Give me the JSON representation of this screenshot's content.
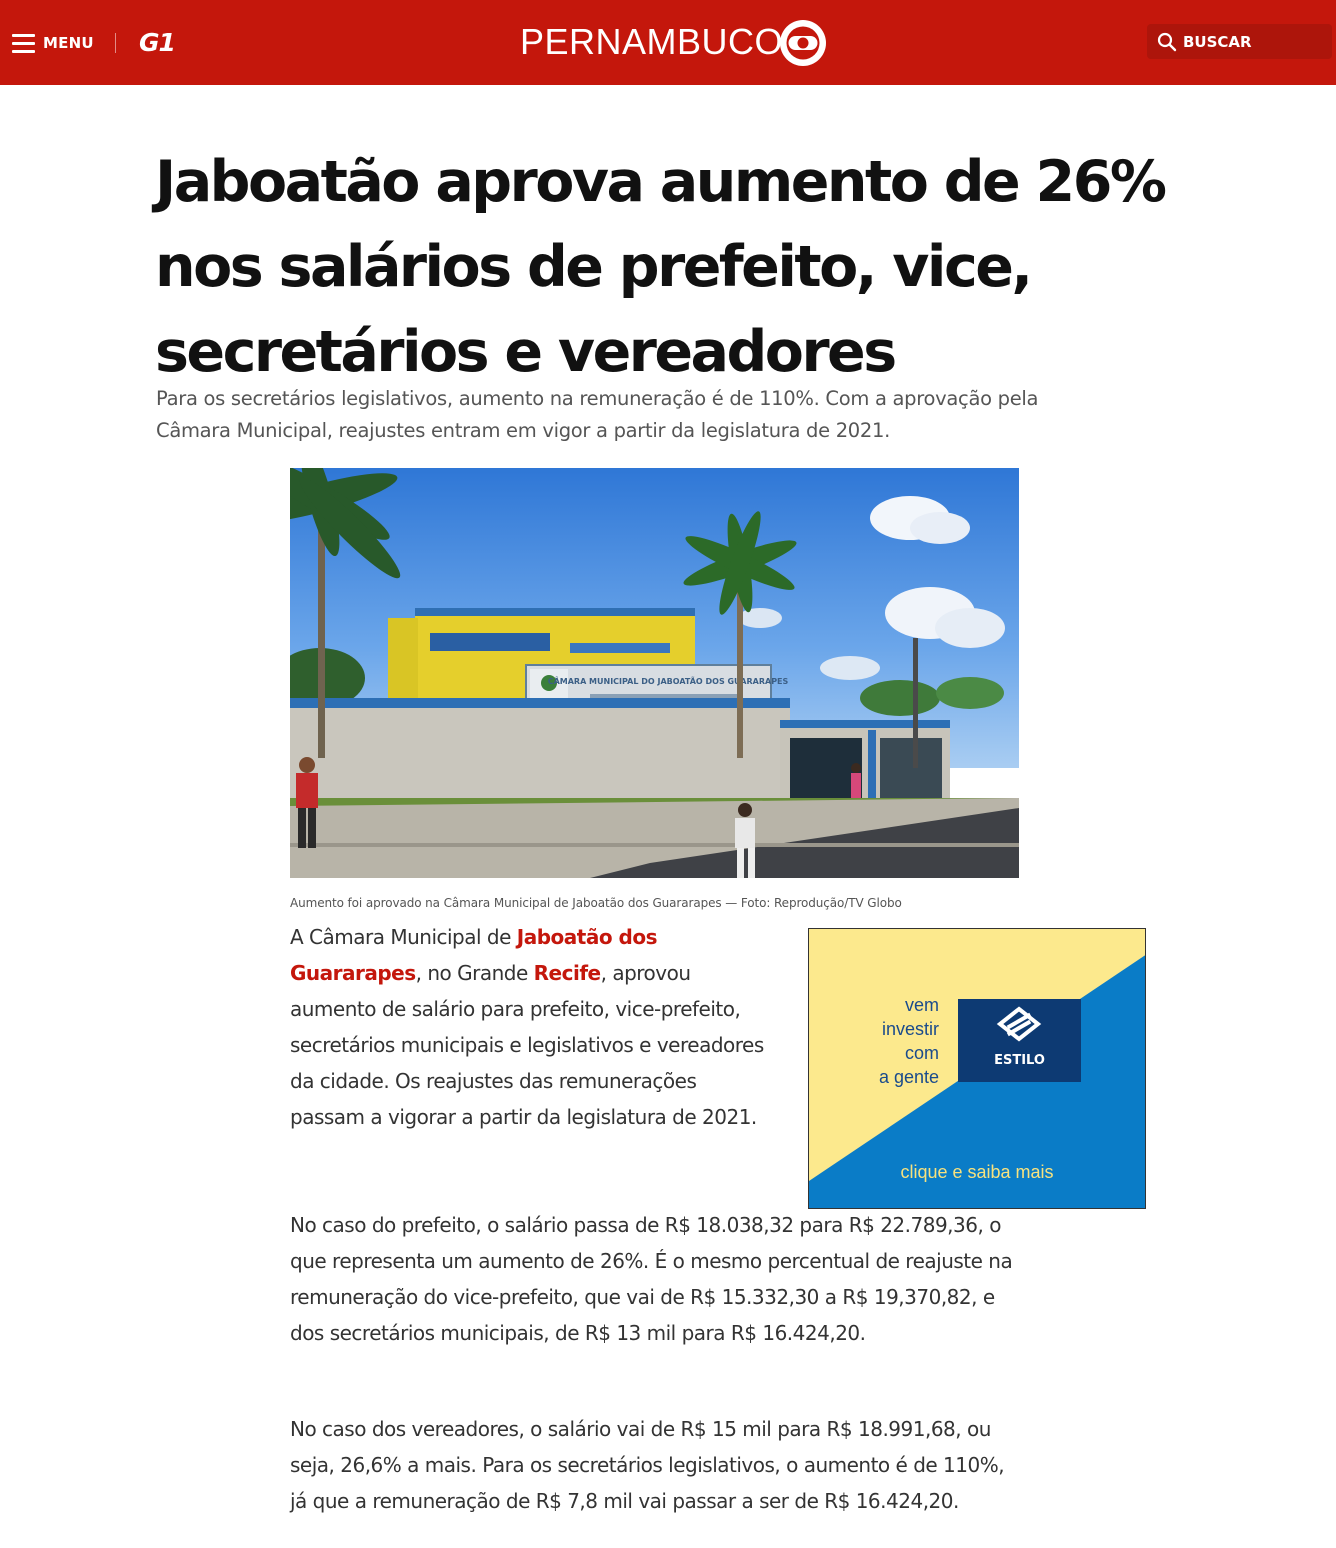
{
  "header": {
    "menu_label": "MENU",
    "logo_text": "G1",
    "section": "PERNAMBUCO",
    "search_label": "BUSCAR",
    "colors": {
      "brand_red": "#c4170c",
      "search_bg": "#ad150b"
    }
  },
  "article": {
    "headline": "Jaboatão aprova aumento de 26% nos salários de prefeito, vice, secretários e vereadores",
    "subtitle": "Para os secretários legislativos, aumento na remuneração é de 110%. Com a aprovação pela Câmara Municipal, reajustes entram em vigor a partir da legislatura de 2021.",
    "image": {
      "sign_text": "CÂMARA MUNICIPAL DO JABOATÃO DOS GUARARAPES",
      "caption": "Aumento foi aprovado na Câmara Municipal de Jaboatão dos Guararapes — Foto: Reprodução/TV Globo"
    },
    "p1": {
      "before": "A Câmara Municipal de ",
      "link1": "Jaboatão dos Guararapes",
      "middle": ", no Grande ",
      "link2": "Recife",
      "after": ", aprovou aumento de salário para prefeito, vice-prefeito, secretários municipais e legislativos e vereadores da cidade. Os reajustes das remunerações passam a vigorar a partir da legislatura de 2021."
    },
    "p2": "No caso do prefeito, o salário passa de R$ 18.038,32 para R$ 22.789,36, o que representa um aumento de 26%. É o mesmo percentual de reajuste na remuneração do vice-prefeito, que vai de R$ 15.332,30 a R$ 19,370,82, e dos secretários municipais, de R$ 13 mil para R$ 16.424,20.",
    "p3": "No caso dos vereadores, o salário vai de R$ 15 mil para R$ 18.991,68, ou seja, 26,6% a mais. Para os secretários legislativos, o aumento é de 110%, já que a remuneração de R$ 7,8 mil vai passar a ser de R$ 16.424,20."
  },
  "ad": {
    "text_lines": [
      "vem",
      "investir",
      "com",
      "a gente"
    ],
    "brand": "ESTILO",
    "cta": "clique e saiba mais",
    "colors": {
      "yellow": "#fce98d",
      "blue": "#0a7cc7",
      "logo_bg": "#0d3a73"
    }
  }
}
